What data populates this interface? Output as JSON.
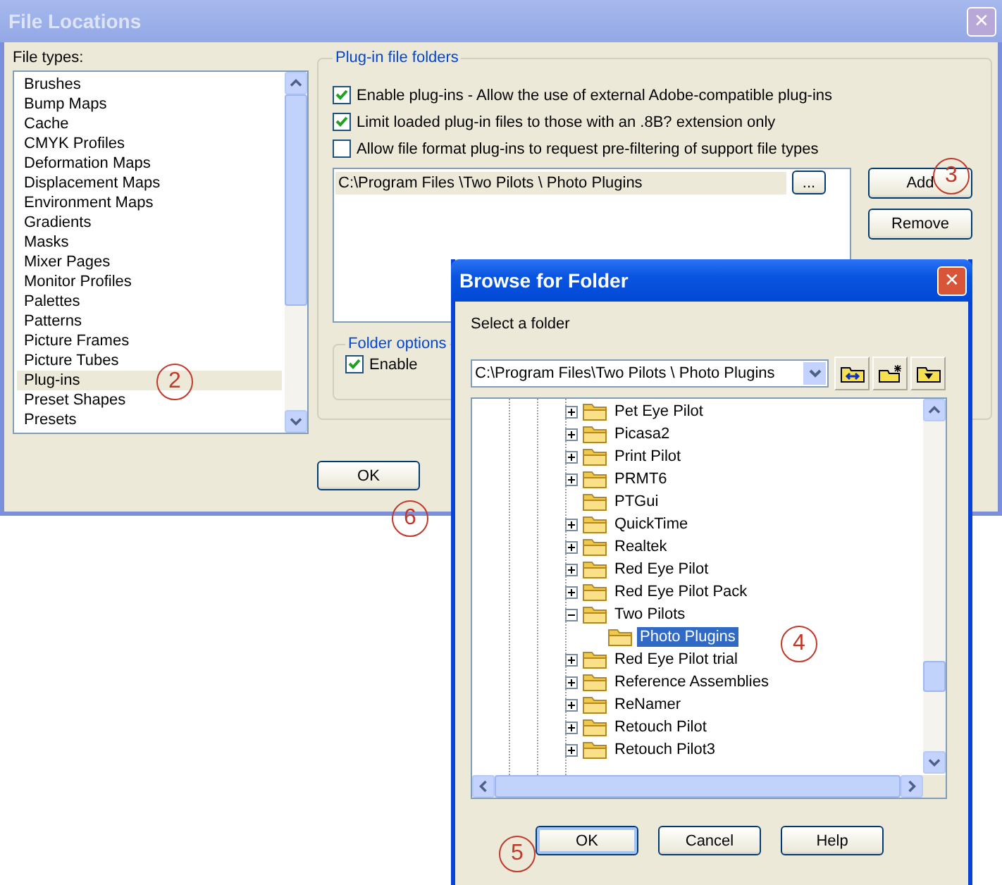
{
  "main_window": {
    "title": "File Locations",
    "close": "✕"
  },
  "file_types": {
    "label": "File types:",
    "items": [
      {
        "label": "Brushes",
        "selected": false
      },
      {
        "label": "Bump Maps",
        "selected": false
      },
      {
        "label": "Cache",
        "selected": false
      },
      {
        "label": "CMYK Profiles",
        "selected": false
      },
      {
        "label": "Deformation Maps",
        "selected": false
      },
      {
        "label": "Displacement Maps",
        "selected": false
      },
      {
        "label": "Environment Maps",
        "selected": false
      },
      {
        "label": "Gradients",
        "selected": false
      },
      {
        "label": "Masks",
        "selected": false
      },
      {
        "label": "Mixer Pages",
        "selected": false
      },
      {
        "label": "Monitor Profiles",
        "selected": false
      },
      {
        "label": "Palettes",
        "selected": false
      },
      {
        "label": "Patterns",
        "selected": false
      },
      {
        "label": "Picture Frames",
        "selected": false
      },
      {
        "label": "Picture Tubes",
        "selected": false
      },
      {
        "label": "Plug-ins",
        "selected": true
      },
      {
        "label": "Preset Shapes",
        "selected": false
      },
      {
        "label": "Presets",
        "selected": false
      }
    ]
  },
  "plugin_folders": {
    "title": "Plug-in file folders",
    "options": [
      {
        "label": "Enable plug-ins - Allow the use of external Adobe-compatible plug-ins",
        "checked": true
      },
      {
        "label": "Limit loaded plug-in files to those with an .8B? extension only",
        "checked": true
      },
      {
        "label": "Allow file format plug-ins to request pre-filtering of support file types",
        "checked": false
      }
    ],
    "folders": [
      "C:\\Program Files \\Two Pilots \\ Photo Plugins"
    ],
    "browse_button": "...",
    "add_button": "Add",
    "remove_button": "Remove"
  },
  "folder_options": {
    "title": "Folder options",
    "enable": {
      "label": "Enable",
      "checked": true
    }
  },
  "main_buttons": [
    "OK"
  ],
  "browse_dialog": {
    "title": "Browse for Folder",
    "close": "✕",
    "prompt": "Select a folder",
    "path": "C:\\Program Files\\Two Pilots \\ Photo Plugins",
    "tree": [
      {
        "label": "Pet Eye Pilot",
        "kind": "collapsed",
        "selected": false
      },
      {
        "label": "Picasa2",
        "kind": "collapsed",
        "selected": false
      },
      {
        "label": "Print Pilot",
        "kind": "collapsed",
        "selected": false
      },
      {
        "label": "PRMT6",
        "kind": "collapsed",
        "selected": false
      },
      {
        "label": "PTGui",
        "kind": "leaf",
        "selected": false
      },
      {
        "label": "QuickTime",
        "kind": "collapsed",
        "selected": false
      },
      {
        "label": "Realtek",
        "kind": "collapsed",
        "selected": false
      },
      {
        "label": "Red Eye Pilot",
        "kind": "collapsed",
        "selected": false
      },
      {
        "label": "Red Eye Pilot Pack",
        "kind": "collapsed",
        "selected": false
      },
      {
        "label": "Two Pilots",
        "kind": "expanded",
        "selected": false,
        "children": [
          {
            "label": "Photo Plugins",
            "selected": true
          }
        ]
      },
      {
        "label": "Red Eye Pilot trial",
        "kind": "collapsed",
        "selected": false
      },
      {
        "label": "Reference Assemblies",
        "kind": "collapsed",
        "selected": false
      },
      {
        "label": "ReNamer",
        "kind": "collapsed",
        "selected": false
      },
      {
        "label": "Retouch Pilot",
        "kind": "collapsed",
        "selected": false
      },
      {
        "label": "Retouch Pilot3",
        "kind": "collapsed",
        "selected": false
      }
    ],
    "buttons": [
      "OK",
      "Cancel",
      "Help"
    ]
  },
  "callouts": [
    "2",
    "3",
    "4",
    "5",
    "6"
  ]
}
